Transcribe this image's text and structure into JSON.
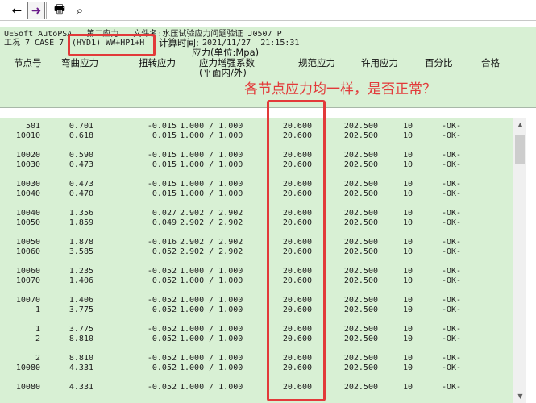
{
  "toolbar": {
    "buttons": [
      {
        "name": "back-arrow-icon",
        "glyph": "←"
      },
      {
        "name": "forward-arrow-icon",
        "glyph": "➜"
      },
      {
        "name": "print-icon",
        "glyph": "🖶"
      },
      {
        "name": "binoculars-icon",
        "glyph": "⌕"
      }
    ]
  },
  "header": {
    "line1": "UESoft AutoPSA   第二应力   文件名:水压试验应力问题验证 J0507 P",
    "case_prefix": "工况 7 CASE 7",
    "case_code": "(HYD1) WW+HP1+H",
    "calc_time_label": "计算时间:",
    "calc_time_value": "2021/11/27  21:15:31",
    "unit_label": "应力(单位:Mpa)",
    "columns": [
      {
        "label": "节点号"
      },
      {
        "label": "弯曲应力"
      },
      {
        "label": "扭转应力"
      },
      {
        "label": "应力增强系数"
      },
      {
        "label": "规范应力"
      },
      {
        "label": "许用应力"
      },
      {
        "label": "百分比"
      },
      {
        "label": "合格"
      }
    ],
    "sif_sub": "(平面内/外)"
  },
  "annotation": {
    "text": "各节点应力均一样，是否正常？",
    "color": "#e23a3a"
  },
  "table": {
    "rows": [
      {
        "node": "501",
        "bend": "0.701",
        "tors": "-0.015",
        "sif": "1.000 / 1.000",
        "code": "20.600",
        "allow": "202.500",
        "pct": "10",
        "ok": "-OK-"
      },
      {
        "node": "10010",
        "bend": "0.618",
        "tors": "0.015",
        "sif": "1.000 / 1.000",
        "code": "20.600",
        "allow": "202.500",
        "pct": "10",
        "ok": "-OK-"
      },
      {
        "node": "10020",
        "bend": "0.590",
        "tors": "-0.015",
        "sif": "1.000 / 1.000",
        "code": "20.600",
        "allow": "202.500",
        "pct": "10",
        "ok": "-OK-"
      },
      {
        "node": "10030",
        "bend": "0.473",
        "tors": "0.015",
        "sif": "1.000 / 1.000",
        "code": "20.600",
        "allow": "202.500",
        "pct": "10",
        "ok": "-OK-"
      },
      {
        "node": "10030",
        "bend": "0.473",
        "tors": "-0.015",
        "sif": "1.000 / 1.000",
        "code": "20.600",
        "allow": "202.500",
        "pct": "10",
        "ok": "-OK-"
      },
      {
        "node": "10040",
        "bend": "0.470",
        "tors": "0.015",
        "sif": "1.000 / 1.000",
        "code": "20.600",
        "allow": "202.500",
        "pct": "10",
        "ok": "-OK-"
      },
      {
        "node": "10040",
        "bend": "1.356",
        "tors": "0.027",
        "sif": "2.902 / 2.902",
        "code": "20.600",
        "allow": "202.500",
        "pct": "10",
        "ok": "-OK-"
      },
      {
        "node": "10050",
        "bend": "1.859",
        "tors": "0.049",
        "sif": "2.902 / 2.902",
        "code": "20.600",
        "allow": "202.500",
        "pct": "10",
        "ok": "-OK-"
      },
      {
        "node": "10050",
        "bend": "1.878",
        "tors": "-0.016",
        "sif": "2.902 / 2.902",
        "code": "20.600",
        "allow": "202.500",
        "pct": "10",
        "ok": "-OK-"
      },
      {
        "node": "10060",
        "bend": "3.585",
        "tors": "0.052",
        "sif": "2.902 / 2.902",
        "code": "20.600",
        "allow": "202.500",
        "pct": "10",
        "ok": "-OK-"
      },
      {
        "node": "10060",
        "bend": "1.235",
        "tors": "-0.052",
        "sif": "1.000 / 1.000",
        "code": "20.600",
        "allow": "202.500",
        "pct": "10",
        "ok": "-OK-"
      },
      {
        "node": "10070",
        "bend": "1.406",
        "tors": "0.052",
        "sif": "1.000 / 1.000",
        "code": "20.600",
        "allow": "202.500",
        "pct": "10",
        "ok": "-OK-"
      },
      {
        "node": "10070",
        "bend": "1.406",
        "tors": "-0.052",
        "sif": "1.000 / 1.000",
        "code": "20.600",
        "allow": "202.500",
        "pct": "10",
        "ok": "-OK-"
      },
      {
        "node": "1",
        "bend": "3.775",
        "tors": "0.052",
        "sif": "1.000 / 1.000",
        "code": "20.600",
        "allow": "202.500",
        "pct": "10",
        "ok": "-OK-"
      },
      {
        "node": "1",
        "bend": "3.775",
        "tors": "-0.052",
        "sif": "1.000 / 1.000",
        "code": "20.600",
        "allow": "202.500",
        "pct": "10",
        "ok": "-OK-"
      },
      {
        "node": "2",
        "bend": "8.810",
        "tors": "0.052",
        "sif": "1.000 / 1.000",
        "code": "20.600",
        "allow": "202.500",
        "pct": "10",
        "ok": "-OK-"
      },
      {
        "node": "2",
        "bend": "8.810",
        "tors": "-0.052",
        "sif": "1.000 / 1.000",
        "code": "20.600",
        "allow": "202.500",
        "pct": "10",
        "ok": "-OK-"
      },
      {
        "node": "10080",
        "bend": "4.331",
        "tors": "0.052",
        "sif": "1.000 / 1.000",
        "code": "20.600",
        "allow": "202.500",
        "pct": "10",
        "ok": "-OK-"
      },
      {
        "node": "10080",
        "bend": "4.331",
        "tors": "-0.052",
        "sif": "1.000 / 1.000",
        "code": "20.600",
        "allow": "202.500",
        "pct": "10",
        "ok": "-OK-"
      }
    ]
  }
}
